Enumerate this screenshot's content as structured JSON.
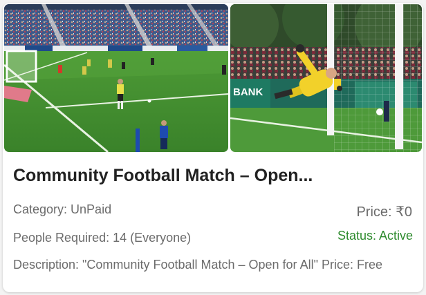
{
  "card": {
    "images": [
      {
        "alt_icon": "stadium-match-photo"
      },
      {
        "alt_icon": "goalkeeper-dive-photo"
      }
    ],
    "title": "Community Football Match – Open...",
    "category_text": "Category: UnPaid",
    "price_text": "Price: ₹0",
    "people_text": "People Required: 14 (Everyone)",
    "status_text": "Status: Active",
    "description_text": "Description: \"Community Football Match – Open for All\" Price: Free",
    "colors": {
      "status": "#2e8b2e",
      "title": "#212121",
      "meta": "#6b6b6b",
      "pitch": "#3f8a2f"
    }
  }
}
